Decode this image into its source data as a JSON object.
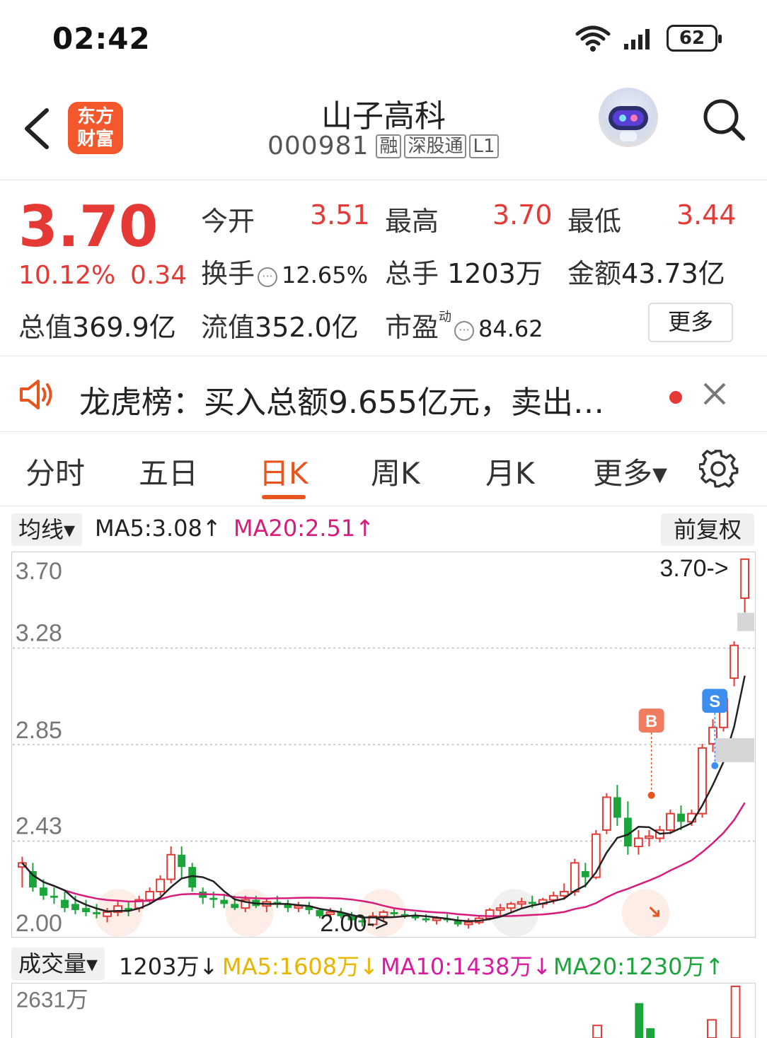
{
  "status_bar": {
    "time": "02:42",
    "battery": "62",
    "icons": [
      "wifi-icon",
      "signal-icon",
      "battery-icon"
    ]
  },
  "header": {
    "brand_line1": "东方",
    "brand_line2": "财富",
    "stock_name": "山子高科",
    "stock_code": "000981",
    "tags": [
      "融",
      "深股通",
      "L1"
    ]
  },
  "quote": {
    "last_price": "3.70",
    "change_pct": "10.12%",
    "change_abs": "0.34",
    "open_label": "今开",
    "open_value": "3.51",
    "high_label": "最高",
    "high_value": "3.70",
    "low_label": "最低",
    "low_value": "3.44",
    "turnover_label": "换手",
    "turnover_value": "12.65%",
    "volume_label": "总手",
    "volume_value": "1203万",
    "amount_label": "金额",
    "amount_value": "43.73亿",
    "mktcap_label": "总值",
    "mktcap_value": "369.9亿",
    "float_label": "流值",
    "float_value": "352.0亿",
    "pe_label": "市盈",
    "pe_sup": "动",
    "pe_value": "84.62",
    "more_label": "更多"
  },
  "notice": {
    "text": "龙虎榜：买入总额9.655亿元，卖出…"
  },
  "tabs": {
    "items": [
      "分时",
      "五日",
      "日K",
      "周K",
      "月K",
      "更多▾"
    ],
    "active": "日K"
  },
  "kline": {
    "indicator_label": "均线▾",
    "ma5_label": "MA5:3.08↑",
    "ma20_label": "MA20:2.51↑",
    "adjust_label": "前复权",
    "price_labels": [
      "3.70",
      "3.28",
      "2.85",
      "2.43",
      "2.00"
    ],
    "last_marker": "3.70->",
    "low_marker": "2.00->",
    "buy_badge": "B",
    "sell_badge": "S",
    "colors": {
      "up": "#e53935",
      "down": "#1aa43a",
      "ma5": "#222222",
      "ma20": "#d81b7a"
    }
  },
  "volume": {
    "indicator_label": "成交量▾",
    "current": "1203万↓",
    "ma5_label": "MA5:1608万↓",
    "ma10_label": "MA10:1438万↓",
    "ma20_label": "MA20:1230万↑",
    "max_label": "2631万",
    "colors": {
      "ma5": "#e8b400",
      "ma10": "#d81b9e",
      "ma20": "#1aa43a"
    }
  },
  "chart_data": {
    "type": "candlestick",
    "title": "",
    "ylim": [
      2.0,
      3.7
    ],
    "y_ticks": [
      3.7,
      3.28,
      2.85,
      2.43,
      2.0
    ],
    "candles": [
      {
        "o": 2.2,
        "h": 2.25,
        "l": 2.1,
        "c": 2.22
      },
      {
        "o": 2.18,
        "h": 2.22,
        "l": 2.08,
        "c": 2.1
      },
      {
        "o": 2.1,
        "h": 2.14,
        "l": 2.04,
        "c": 2.06
      },
      {
        "o": 2.06,
        "h": 2.1,
        "l": 2.02,
        "c": 2.05
      },
      {
        "o": 2.04,
        "h": 2.08,
        "l": 1.98,
        "c": 2.0
      },
      {
        "o": 2.02,
        "h": 2.06,
        "l": 1.97,
        "c": 1.99
      },
      {
        "o": 2.0,
        "h": 2.04,
        "l": 1.96,
        "c": 1.98
      },
      {
        "o": 1.98,
        "h": 2.02,
        "l": 1.95,
        "c": 1.97
      },
      {
        "o": 1.96,
        "h": 2.0,
        "l": 1.93,
        "c": 1.98
      },
      {
        "o": 1.98,
        "h": 2.04,
        "l": 1.96,
        "c": 2.01
      },
      {
        "o": 2.0,
        "h": 2.03,
        "l": 1.96,
        "c": 1.99
      },
      {
        "o": 2.0,
        "h": 2.06,
        "l": 1.98,
        "c": 2.04
      },
      {
        "o": 2.04,
        "h": 2.1,
        "l": 2.02,
        "c": 2.08
      },
      {
        "o": 2.08,
        "h": 2.16,
        "l": 2.06,
        "c": 2.14
      },
      {
        "o": 2.14,
        "h": 2.3,
        "l": 2.12,
        "c": 2.26
      },
      {
        "o": 2.26,
        "h": 2.3,
        "l": 2.14,
        "c": 2.2
      },
      {
        "o": 2.2,
        "h": 2.22,
        "l": 2.08,
        "c": 2.1
      },
      {
        "o": 2.08,
        "h": 2.1,
        "l": 2.02,
        "c": 2.05
      },
      {
        "o": 2.05,
        "h": 2.08,
        "l": 2.0,
        "c": 2.04
      },
      {
        "o": 2.04,
        "h": 2.07,
        "l": 2.0,
        "c": 2.02
      },
      {
        "o": 2.02,
        "h": 2.06,
        "l": 1.99,
        "c": 2.0
      },
      {
        "o": 2.0,
        "h": 2.06,
        "l": 1.98,
        "c": 2.04
      },
      {
        "o": 2.04,
        "h": 2.06,
        "l": 2.0,
        "c": 2.01
      },
      {
        "o": 2.01,
        "h": 2.05,
        "l": 1.98,
        "c": 2.03
      },
      {
        "o": 2.03,
        "h": 2.06,
        "l": 2.0,
        "c": 2.02
      },
      {
        "o": 2.02,
        "h": 2.04,
        "l": 1.98,
        "c": 2.0
      },
      {
        "o": 2.0,
        "h": 2.03,
        "l": 1.98,
        "c": 2.01
      },
      {
        "o": 2.01,
        "h": 2.03,
        "l": 1.97,
        "c": 1.99
      },
      {
        "o": 1.99,
        "h": 2.0,
        "l": 1.95,
        "c": 1.96
      },
      {
        "o": 1.97,
        "h": 2.0,
        "l": 1.95,
        "c": 1.98
      },
      {
        "o": 1.98,
        "h": 2.0,
        "l": 1.95,
        "c": 1.96
      },
      {
        "o": 1.96,
        "h": 1.98,
        "l": 1.93,
        "c": 1.94
      },
      {
        "o": 1.94,
        "h": 1.96,
        "l": 1.91,
        "c": 1.93
      },
      {
        "o": 1.92,
        "h": 1.98,
        "l": 1.91,
        "c": 1.96
      },
      {
        "o": 1.96,
        "h": 1.99,
        "l": 1.94,
        "c": 1.98
      },
      {
        "o": 1.98,
        "h": 2.0,
        "l": 1.96,
        "c": 1.97
      },
      {
        "o": 1.97,
        "h": 1.99,
        "l": 1.95,
        "c": 1.96
      },
      {
        "o": 1.96,
        "h": 1.98,
        "l": 1.94,
        "c": 1.95
      },
      {
        "o": 1.95,
        "h": 1.97,
        "l": 1.93,
        "c": 1.94
      },
      {
        "o": 1.94,
        "h": 1.96,
        "l": 1.92,
        "c": 1.95
      },
      {
        "o": 1.95,
        "h": 1.97,
        "l": 1.93,
        "c": 1.94
      },
      {
        "o": 1.94,
        "h": 1.96,
        "l": 1.91,
        "c": 1.92
      },
      {
        "o": 1.92,
        "h": 1.95,
        "l": 1.9,
        "c": 1.93
      },
      {
        "o": 1.93,
        "h": 1.96,
        "l": 1.92,
        "c": 1.95
      },
      {
        "o": 1.95,
        "h": 2.0,
        "l": 1.94,
        "c": 1.99
      },
      {
        "o": 1.99,
        "h": 2.02,
        "l": 1.96,
        "c": 2.0
      },
      {
        "o": 2.0,
        "h": 2.03,
        "l": 1.98,
        "c": 2.02
      },
      {
        "o": 2.02,
        "h": 2.05,
        "l": 2.0,
        "c": 2.03
      },
      {
        "o": 2.03,
        "h": 2.06,
        "l": 2.0,
        "c": 2.02
      },
      {
        "o": 2.02,
        "h": 2.05,
        "l": 2.0,
        "c": 2.04
      },
      {
        "o": 2.04,
        "h": 2.08,
        "l": 2.02,
        "c": 2.06
      },
      {
        "o": 2.06,
        "h": 2.12,
        "l": 2.04,
        "c": 2.08
      },
      {
        "o": 2.08,
        "h": 2.24,
        "l": 2.06,
        "c": 2.22
      },
      {
        "o": 2.18,
        "h": 2.22,
        "l": 2.1,
        "c": 2.15
      },
      {
        "o": 2.15,
        "h": 2.38,
        "l": 2.14,
        "c": 2.36
      },
      {
        "o": 2.38,
        "h": 2.56,
        "l": 2.36,
        "c": 2.54
      },
      {
        "o": 2.54,
        "h": 2.6,
        "l": 2.4,
        "c": 2.44
      },
      {
        "o": 2.44,
        "h": 2.52,
        "l": 2.26,
        "c": 2.3
      },
      {
        "o": 2.3,
        "h": 2.38,
        "l": 2.26,
        "c": 2.34
      },
      {
        "o": 2.34,
        "h": 2.38,
        "l": 2.3,
        "c": 2.35
      },
      {
        "o": 2.34,
        "h": 2.4,
        "l": 2.32,
        "c": 2.38
      },
      {
        "o": 2.38,
        "h": 2.48,
        "l": 2.36,
        "c": 2.46
      },
      {
        "o": 2.46,
        "h": 2.5,
        "l": 2.38,
        "c": 2.42
      },
      {
        "o": 2.42,
        "h": 2.48,
        "l": 2.4,
        "c": 2.46
      },
      {
        "o": 2.46,
        "h": 2.8,
        "l": 2.44,
        "c": 2.78
      },
      {
        "o": 2.8,
        "h": 2.92,
        "l": 2.76,
        "c": 2.88
      },
      {
        "o": 2.88,
        "h": 3.05,
        "l": 2.86,
        "c": 3.02
      },
      {
        "o": 3.12,
        "h": 3.3,
        "l": 3.08,
        "c": 3.28
      },
      {
        "o": 3.51,
        "h": 3.7,
        "l": 3.44,
        "c": 3.7
      }
    ],
    "ma5_label": "MA5:3.08",
    "ma20_label": "MA20:2.51"
  }
}
